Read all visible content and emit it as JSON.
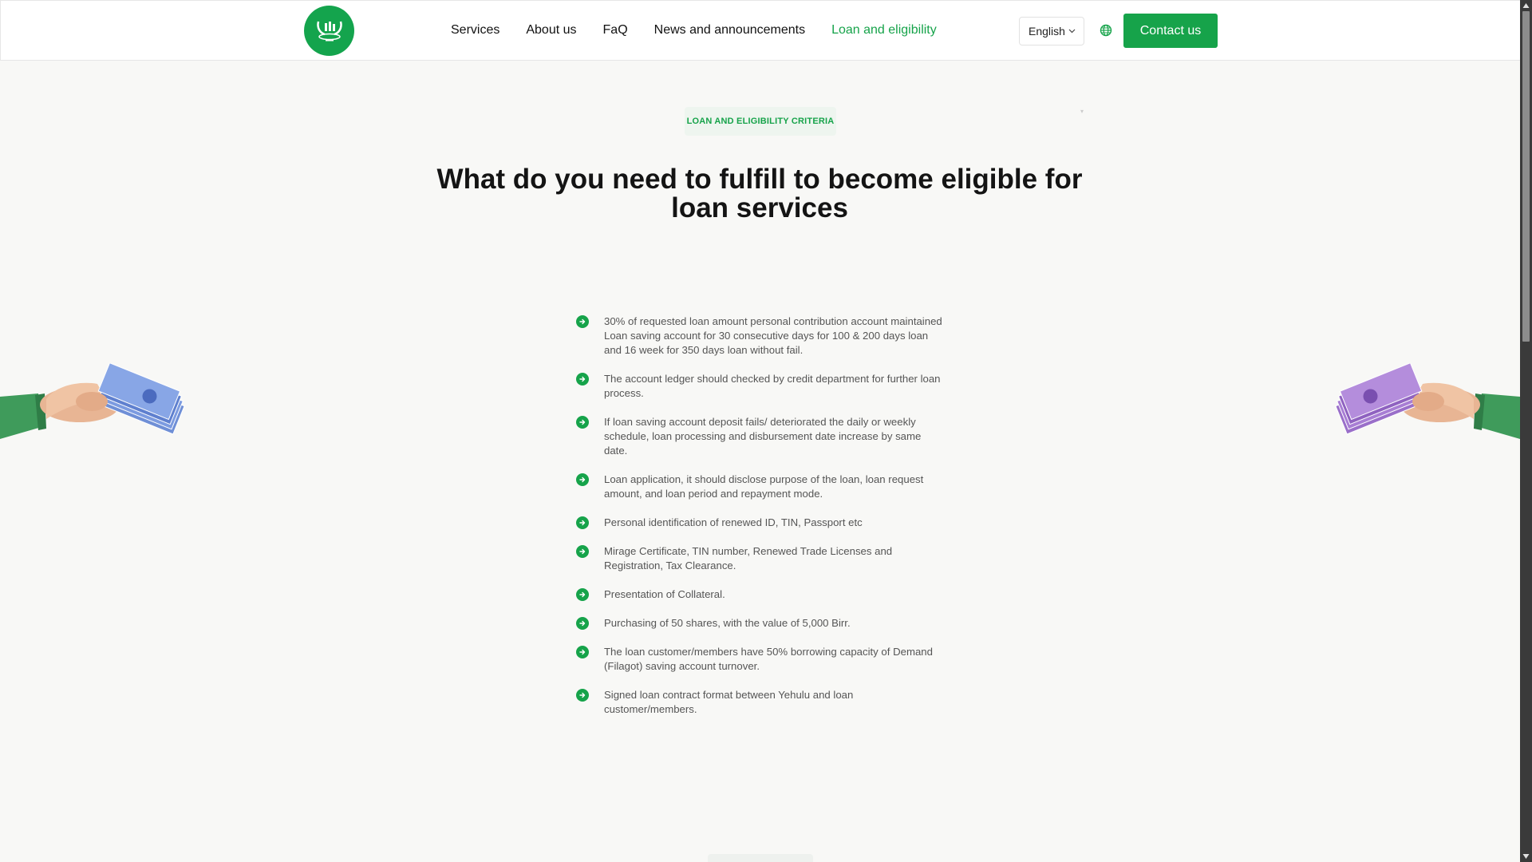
{
  "header": {
    "nav": [
      {
        "label": "Services",
        "active": false
      },
      {
        "label": "About us",
        "active": false
      },
      {
        "label": "FaQ",
        "active": false
      },
      {
        "label": "News and announcements",
        "active": false
      },
      {
        "label": "Loan and eligibility",
        "active": true
      }
    ],
    "language": "English",
    "contact_label": "Contact us"
  },
  "section": {
    "badge": "LOAN AND ELIGIBILITY CRITERIA",
    "title": "What do you need to fulfill to become eligible for loan services",
    "criteria": [
      "30% of requested loan amount personal contribution account maintained Loan saving account for 30 consecutive days for 100 & 200 days loan and 16 week for 350 days loan without fail.",
      "The account ledger should checked by credit department for further loan process.",
      "If loan saving account deposit fails/ deteriorated the daily or weekly schedule, loan processing and disbursement date increase by same date.",
      "Loan application, it should disclose purpose of the loan, loan request amount, and loan period and repayment mode.",
      "Personal identification of renewed ID, TIN, Passport etc",
      "Mirage Certificate, TIN number, Renewed Trade Licenses and Registration, Tax Clearance.",
      "Presentation of Collateral.",
      "Purchasing of 50 shares, with the value of 5,000 Birr.",
      "The loan customer/members have 50% borrowing capacity of Demand (Filagot) saving account turnover.",
      "Signed loan contract format between Yehulu and loan customer/members."
    ]
  },
  "colors": {
    "accent": "#16a34a",
    "badge_bg": "#eef5ef",
    "page_bg": "#f8f8f6"
  },
  "icons": {
    "bullet": "arrow-right-circle-icon",
    "globe": "globe-icon",
    "chevron": "chevron-down-icon"
  }
}
